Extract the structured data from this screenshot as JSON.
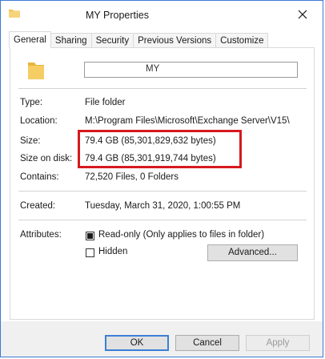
{
  "window": {
    "title": "MY Properties",
    "close_label": "✕"
  },
  "tabs": [
    "General",
    "Sharing",
    "Security",
    "Previous Versions",
    "Customize"
  ],
  "general": {
    "name_value": "MY",
    "type_label": "Type:",
    "type_value": "File folder",
    "location_label": "Location:",
    "location_value": "M:\\Program Files\\Microsoft\\Exchange Server\\V15\\",
    "size_label": "Size:",
    "size_value": "79.4 GB (85,301,829,632 bytes)",
    "size_on_disk_label": "Size on disk:",
    "size_on_disk_value": "79.4 GB (85,301,919,744 bytes)",
    "contains_label": "Contains:",
    "contains_value": "72,520 Files, 0 Folders",
    "created_label": "Created:",
    "created_value": "Tuesday, March 31, 2020, 1:00:55 PM",
    "attributes_label": "Attributes:",
    "readonly_label": "Read-only (Only applies to files in folder)",
    "readonly_checked": true,
    "hidden_label": "Hidden",
    "hidden_checked": false,
    "advanced_label": "Advanced..."
  },
  "buttons": {
    "ok": "OK",
    "cancel": "Cancel",
    "apply": "Apply"
  },
  "colors": {
    "highlight_box": "#d5191f",
    "folder": "#f2c24f",
    "focus_border": "#3c7fd6"
  }
}
